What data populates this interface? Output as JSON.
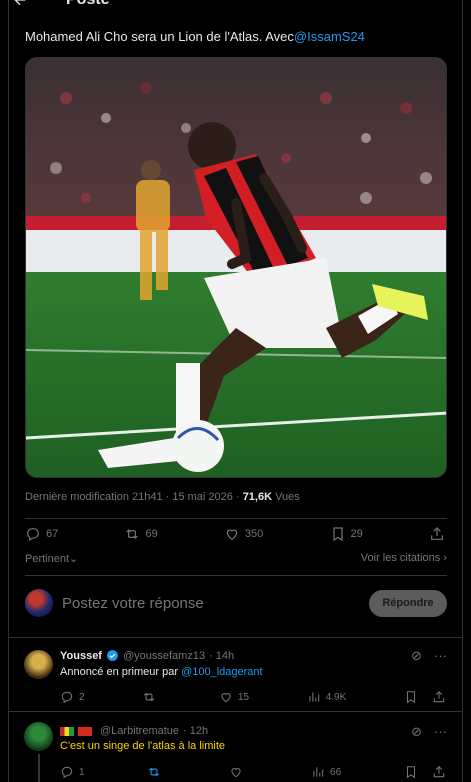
{
  "header": {
    "title": "Poste"
  },
  "tweet": {
    "text": "Mohamed Ali Cho sera un Lion de l'Atlas. Avec",
    "mention": "@IssamS24",
    "meta_time": "Dernière modification 21h41 · 15 mai 2026 · ",
    "views_count": "71,6K",
    "views_label": " Vues"
  },
  "actions": {
    "replies": "67",
    "reposts": "69",
    "likes": "350",
    "bookmarks": "29"
  },
  "sort": {
    "label": "Pertinent",
    "quotes": "Voir les citations"
  },
  "composer": {
    "placeholder": "Postez votre réponse",
    "button": "Répondre"
  },
  "replies": [
    {
      "name": "Youssef",
      "handle": "@youssefamz13",
      "time": "· 14h",
      "text": "Annoncé en primeur par ",
      "mention": "@100_ldagerant",
      "replies": "2",
      "reposts": "",
      "likes": "15",
      "views": "4.9K"
    },
    {
      "name": "",
      "handle": "@Larbitrematue",
      "time": "· 12h",
      "text": "C'est un singe de l'atlas à la limite",
      "replies": "1",
      "reposts": "",
      "likes": "",
      "views": "66"
    }
  ],
  "colors": {
    "accent": "#1d9bf0",
    "text": "#e7e9ea",
    "muted": "#71767b",
    "reply_yellow": "#ffd400"
  }
}
